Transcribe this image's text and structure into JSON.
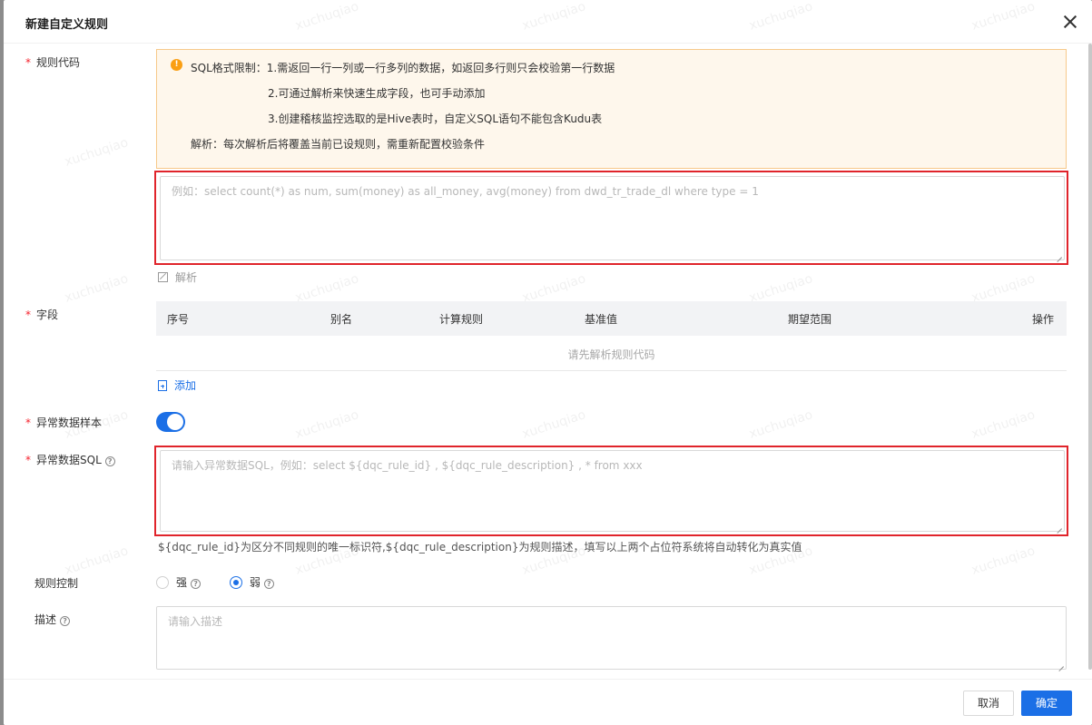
{
  "dialog": {
    "title": "新建自定义规则"
  },
  "fields": {
    "rule_code_label": "规则代码",
    "field_label": "字段",
    "abnormal_sample_label": "异常数据样本",
    "abnormal_sql_label": "异常数据SQL",
    "rule_control_label": "规则控制",
    "description_label": "描述"
  },
  "notice": {
    "line1": "SQL格式限制：1.需返回一行一列或一行多列的数据，如返回多行则只会校验第一行数据",
    "line2": "2.可通过解析来快速生成字段，也可手动添加",
    "line3": "3.创建稽核监控选取的是Hive表时，自定义SQL语句不能包含Kudu表",
    "line4": "解析：每次解析后将覆盖当前已设规则，需重新配置校验条件"
  },
  "rule_code_input": {
    "placeholder": "例如：select count(*) as num, sum(money) as all_money, avg(money) from dwd_tr_trade_dl where type = 1",
    "value": ""
  },
  "parse_link": "解析",
  "table": {
    "columns": [
      "序号",
      "别名",
      "计算规则",
      "基准值",
      "期望范围",
      "操作"
    ],
    "empty_text": "请先解析规则代码"
  },
  "add_link": "添加",
  "abnormal_sample_switch": {
    "on": true
  },
  "abnormal_sql_input": {
    "placeholder": "请输入异常数据SQL，例如：select ${dqc_rule_id} , ${dqc_rule_description} , * from xxx",
    "value": ""
  },
  "abnormal_sql_hint": "${dqc_rule_id}为区分不同规则的唯一标识符,${dqc_rule_description}为规则描述，填写以上两个占位符系统将自动转化为真实值",
  "rule_control": {
    "options": [
      "强",
      "弱"
    ],
    "selected": "弱"
  },
  "description_input": {
    "placeholder": "请输入描述",
    "value": ""
  },
  "footer": {
    "cancel_label": "取消",
    "ok_label": "确定"
  },
  "watermark": "xuchuqiao",
  "colors": {
    "primary": "#1b6fe6",
    "required": "#f5222d",
    "notice_bg": "#fef7ec",
    "notice_border": "#f7c98a",
    "highlight_box": "#e0242b"
  }
}
